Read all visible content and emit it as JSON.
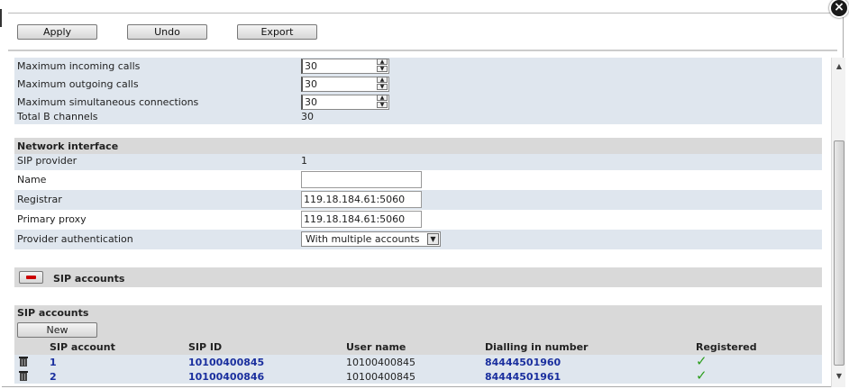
{
  "toolbar": {
    "apply": "Apply",
    "undo": "Undo",
    "export": "Export"
  },
  "settings": {
    "max_incoming_label": "Maximum incoming calls",
    "max_incoming_value": "30",
    "max_outgoing_label": "Maximum outgoing calls",
    "max_outgoing_value": "30",
    "max_simultaneous_label": "Maximum simultaneous connections",
    "max_simultaneous_value": "30",
    "total_b_label": "Total B channels",
    "total_b_value": "30"
  },
  "network": {
    "heading": "Network interface",
    "sip_provider_label": "SIP provider",
    "sip_provider_value": "1",
    "name_label": "Name",
    "name_value": "",
    "registrar_label": "Registrar",
    "registrar_value": "119.18.184.61:5060",
    "primary_proxy_label": "Primary proxy",
    "primary_proxy_value": "119.18.184.61:5060",
    "provider_auth_label": "Provider authentication",
    "provider_auth_value": "With multiple accounts"
  },
  "sip_section": {
    "collapse_title": "SIP accounts"
  },
  "accounts": {
    "heading": "SIP accounts",
    "new_button": "New",
    "columns": {
      "sip_account": "SIP account",
      "sip_id": "SIP ID",
      "user_name": "User name",
      "dialling": "Dialling in number",
      "registered": "Registered"
    },
    "rows": [
      {
        "account": "1",
        "sip_id": "10100400845",
        "user_name": "10100400845",
        "dialling": "84444501960",
        "registered": "✓"
      },
      {
        "account": "2",
        "sip_id": "10100400846",
        "user_name": "10100400845",
        "dialling": "84444501961",
        "registered": "✓"
      }
    ]
  },
  "icons": {
    "close": "close-icon",
    "delete": "trash-icon",
    "registered": "checkmark-icon"
  },
  "colors": {
    "link": "#1a2f9e",
    "alt_row": "#dfe6ee",
    "section": "#d9d9d9",
    "check": "#2d9e1e"
  }
}
